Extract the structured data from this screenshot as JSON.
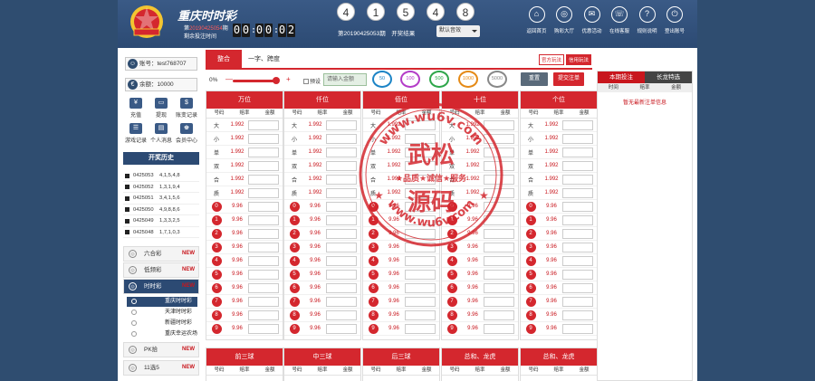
{
  "header": {
    "title": "重庆时时彩",
    "issue_label": "第",
    "issue": "20190425054",
    "issue_suffix": "期",
    "countdown_label": "剩余投注时间",
    "countdown": [
      "0",
      "0",
      "0",
      "0",
      "0",
      "2"
    ],
    "balls": [
      "4",
      "1",
      "5",
      "4",
      "8"
    ],
    "draw_text": "第20190425053期　开奖结果",
    "draw_select": "默认音效"
  },
  "nav": [
    {
      "icon": "⌂",
      "label": "返回首页"
    },
    {
      "icon": "◎",
      "label": "购彩大厅"
    },
    {
      "icon": "✉",
      "label": "优惠活动"
    },
    {
      "icon": "☏",
      "label": "在线客服"
    },
    {
      "icon": "?",
      "label": "规则说明"
    },
    {
      "icon": "⏻",
      "label": "登出账号"
    }
  ],
  "user": {
    "account": "账号：test768707",
    "balance": "余额：10000"
  },
  "account_items": [
    {
      "icon": "¥",
      "label": "充值"
    },
    {
      "icon": "▭",
      "label": "提现"
    },
    {
      "icon": "$",
      "label": "账变记录"
    },
    {
      "icon": "☰",
      "label": "游戏记录"
    },
    {
      "icon": "▤",
      "label": "个人消息"
    },
    {
      "icon": "♚",
      "label": "会员中心"
    }
  ],
  "history_title": "开奖历史",
  "history": [
    {
      "issue": "0425053",
      "nums": "4,1,5,4,8"
    },
    {
      "issue": "0425052",
      "nums": "1,3,1,9,4"
    },
    {
      "issue": "0425051",
      "nums": "3,4,1,5,6"
    },
    {
      "issue": "0425050",
      "nums": "4,9,8,8,6"
    },
    {
      "issue": "0425049",
      "nums": "1,3,3,2,5"
    },
    {
      "issue": "0425048",
      "nums": "1,7,1,0,3"
    }
  ],
  "games": [
    {
      "label": "六合彩",
      "tag": "NEW"
    },
    {
      "label": "低频彩",
      "tag": "NEW"
    },
    {
      "label": "时时彩",
      "tag": "NEW"
    },
    {
      "label": "PK拾",
      "tag": "NEW"
    },
    {
      "label": "11选5",
      "tag": "NEW"
    }
  ],
  "subgames": [
    "重庆时时彩",
    "天津时时彩",
    "新疆时时彩",
    "重庆幸运农场"
  ],
  "tabs": {
    "main": "整合",
    "second": "一字、跨度",
    "right": [
      "官方玩法",
      "信用玩法"
    ]
  },
  "tools": {
    "percent": "0%",
    "minus": "—",
    "plus": "+",
    "preset": "预设",
    "amount_placeholder": "请输入金额",
    "chips": [
      "50",
      "100",
      "500",
      "1000",
      "5000"
    ],
    "reset": "重置",
    "submit": "提交注单"
  },
  "columns": [
    "万位",
    "仟位",
    "佰位",
    "十位",
    "个位"
  ],
  "subheads": [
    "号码",
    "赔率",
    "金额"
  ],
  "text_rows": [
    {
      "label": "大",
      "odds": "1.992"
    },
    {
      "label": "小",
      "odds": "1.992"
    },
    {
      "label": "单",
      "odds": "1.992"
    },
    {
      "label": "双",
      "odds": "1.992"
    },
    {
      "label": "合",
      "odds": "1.992"
    },
    {
      "label": "质",
      "odds": "1.992"
    }
  ],
  "num_rows": [
    {
      "label": "0",
      "odds": "9.96"
    },
    {
      "label": "1",
      "odds": "9.96"
    },
    {
      "label": "2",
      "odds": "9.96"
    },
    {
      "label": "3",
      "odds": "9.96"
    },
    {
      "label": "4",
      "odds": "9.96"
    },
    {
      "label": "5",
      "odds": "9.96"
    },
    {
      "label": "6",
      "odds": "9.96"
    },
    {
      "label": "7",
      "odds": "9.96"
    },
    {
      "label": "8",
      "odds": "9.96"
    },
    {
      "label": "9",
      "odds": "9.96"
    }
  ],
  "bottom_columns": [
    "前三球",
    "中三球",
    "后三球",
    "总和、龙虎",
    "总和、龙虎"
  ],
  "right_panel": {
    "tabs": [
      "本期投注",
      "长龙特选"
    ],
    "heads": [
      "时间",
      "赔率",
      "金额"
    ],
    "empty": "暂无最新注单信息"
  },
  "watermark": {
    "big1": "武松",
    "big2": "源码",
    "ring_top": "www.wu6v.com",
    "ring_bottom": "www.wu6v.com",
    "mid": "★品质★诚信★服务"
  },
  "colors": {
    "red": "#d4272e",
    "navy": "#2c4a73"
  }
}
